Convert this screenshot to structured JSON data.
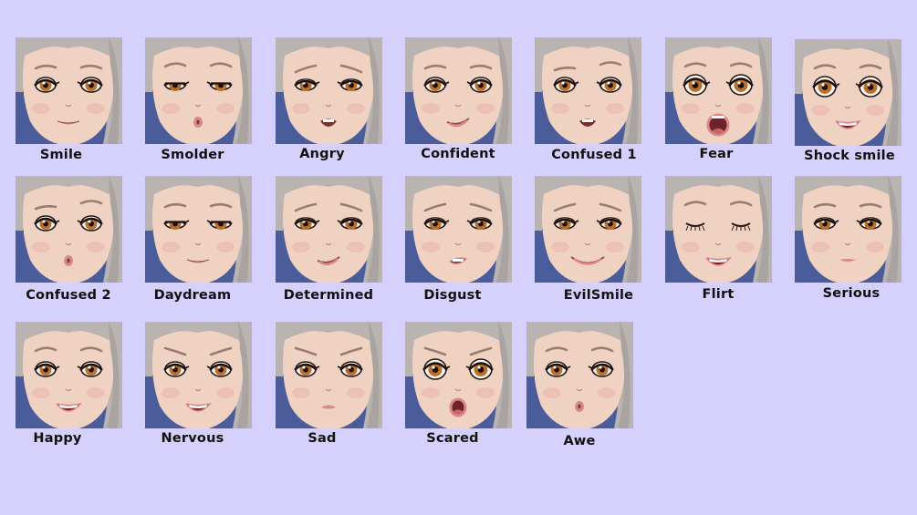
{
  "expressions": [
    {
      "id": "smile",
      "label": "Smile",
      "eyes": "normal",
      "brows": "relaxed",
      "mouth": "smile-closed"
    },
    {
      "id": "smolder",
      "label": "Smolder",
      "eyes": "half",
      "brows": "raised",
      "mouth": "pucker"
    },
    {
      "id": "angry",
      "label": "Angry",
      "eyes": "narrow",
      "brows": "angry",
      "mouth": "open-grim"
    },
    {
      "id": "confident",
      "label": "Confident",
      "eyes": "normal",
      "brows": "relaxed",
      "mouth": "smirk"
    },
    {
      "id": "confused-1",
      "label": "Confused 1",
      "eyes": "normal",
      "brows": "uneven",
      "mouth": "open-grim"
    },
    {
      "id": "fear",
      "label": "Fear",
      "eyes": "wide",
      "brows": "raised",
      "mouth": "open-wide"
    },
    {
      "id": "shock-smile",
      "label": "Shock smile",
      "eyes": "wide",
      "brows": "raised",
      "mouth": "grin-open"
    },
    {
      "id": "confused-2",
      "label": "Confused 2",
      "eyes": "normal",
      "brows": "uneven",
      "mouth": "pucker"
    },
    {
      "id": "daydream",
      "label": "Daydream",
      "eyes": "half",
      "brows": "relaxed",
      "mouth": "smile-closed"
    },
    {
      "id": "determined",
      "label": "Determined",
      "eyes": "narrow",
      "brows": "angry",
      "mouth": "smirk"
    },
    {
      "id": "disgust",
      "label": "Disgust",
      "eyes": "narrow",
      "brows": "angry",
      "mouth": "grimace"
    },
    {
      "id": "evilsmile",
      "label": "EvilSmile",
      "eyes": "narrow",
      "brows": "angry",
      "mouth": "wide-smile"
    },
    {
      "id": "flirt",
      "label": "Flirt",
      "eyes": "closed",
      "brows": "raised",
      "mouth": "grin-open"
    },
    {
      "id": "serious",
      "label": "Serious",
      "eyes": "narrow",
      "brows": "relaxed",
      "mouth": "flat"
    },
    {
      "id": "happy",
      "label": "Happy",
      "eyes": "normal",
      "brows": "raised",
      "mouth": "grin-open"
    },
    {
      "id": "nervous",
      "label": "Nervous",
      "eyes": "normal",
      "brows": "worried",
      "mouth": "grin-open"
    },
    {
      "id": "sad",
      "label": "Sad",
      "eyes": "normal",
      "brows": "worried",
      "mouth": "frown"
    },
    {
      "id": "scared",
      "label": "Scared",
      "eyes": "wide",
      "brows": "worried",
      "mouth": "open-o"
    },
    {
      "id": "awe",
      "label": "Awe",
      "eyes": "normal",
      "brows": "raised",
      "mouth": "pucker"
    }
  ],
  "colors": {
    "page_background": "#d5d0fc",
    "tile_background": "#4a5d9a",
    "hair": "#b9b4b1",
    "skin": "#f0d2c3",
    "iris": "#b9702c",
    "lips": "#d9878a",
    "label_text": "#111111"
  }
}
